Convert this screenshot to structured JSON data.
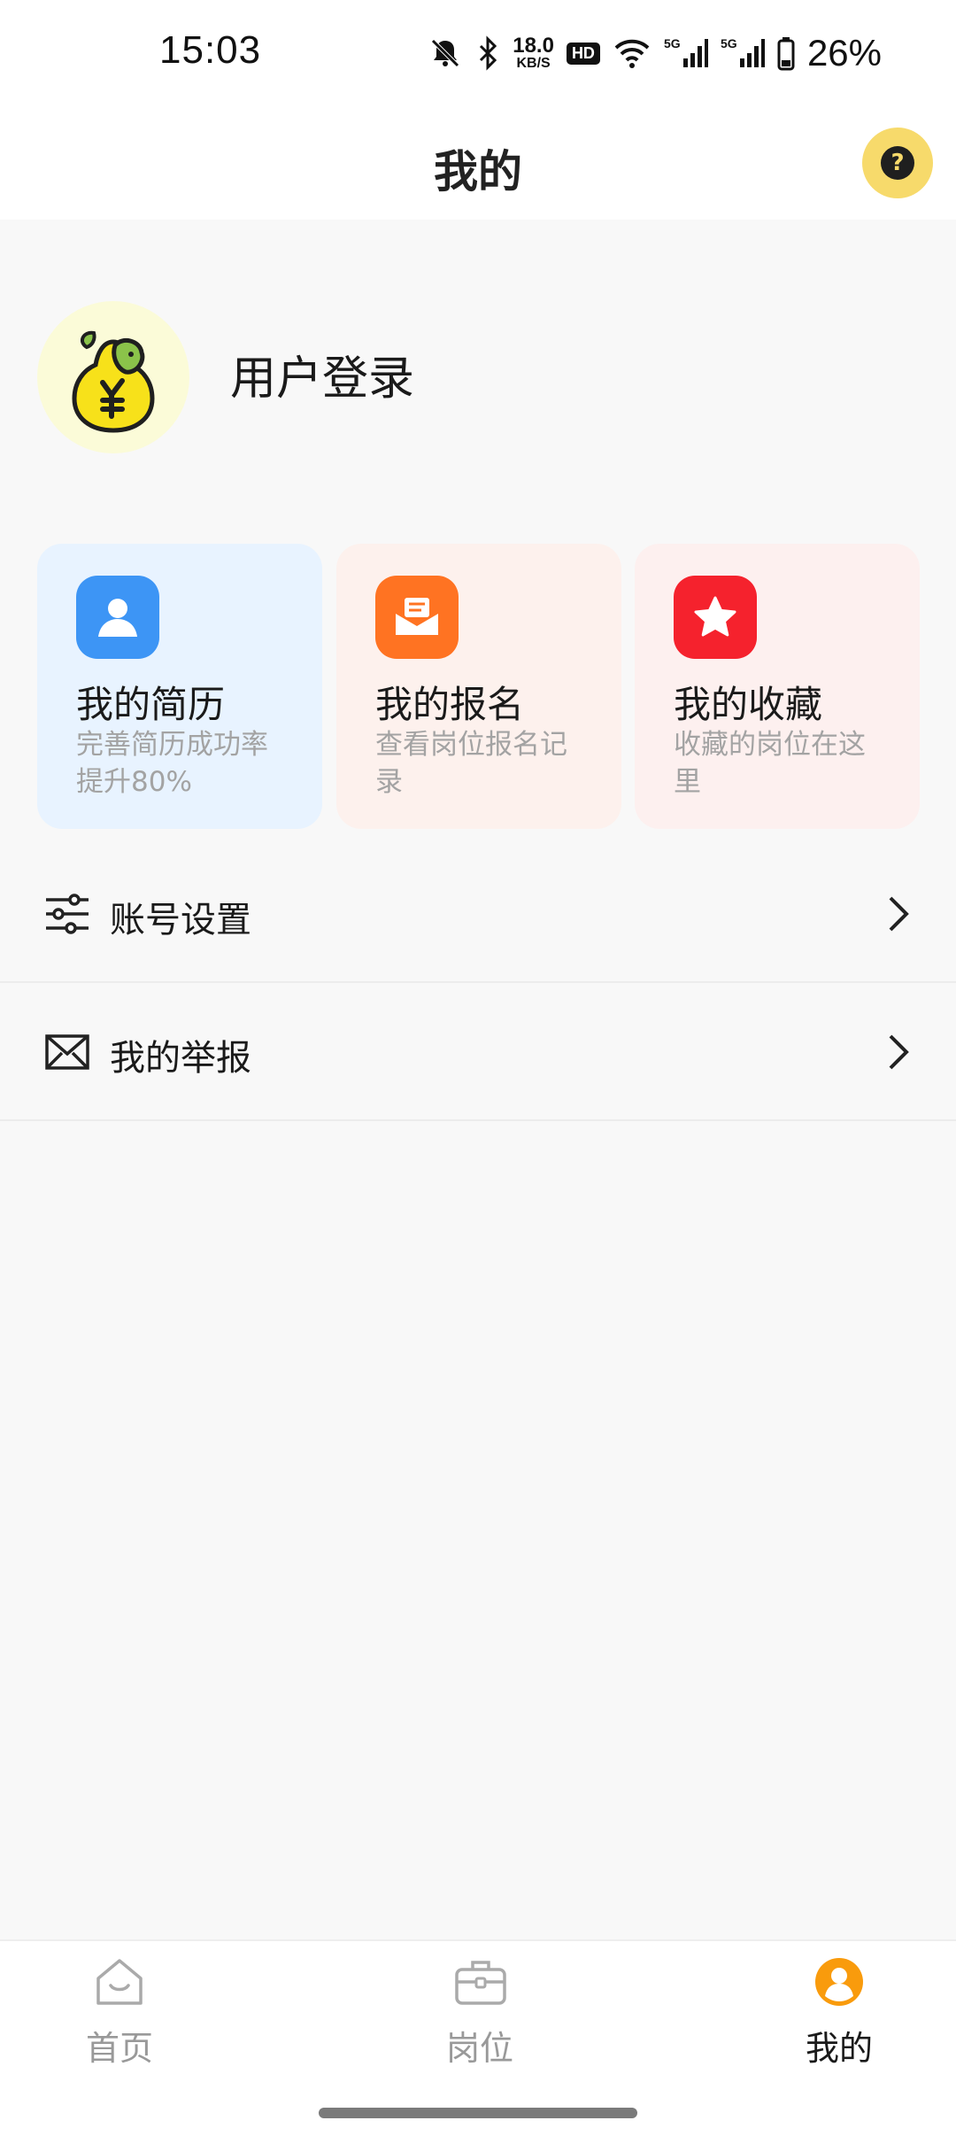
{
  "status_bar": {
    "time": "15:03",
    "speed_value": "18.0",
    "speed_unit": "KB/S",
    "hd_label": "HD",
    "network_1": "5G",
    "network_2": "5G",
    "battery": "26%"
  },
  "header": {
    "title": "我的",
    "help_icon": "question-icon",
    "help_symbol": "?"
  },
  "user": {
    "login_label": "用户登录",
    "avatar_icon": "pear-yuan-logo"
  },
  "cards": [
    {
      "title": "我的简历",
      "desc": "完善简历成功率提升80%",
      "icon": "person-icon",
      "color": "#3d95f5"
    },
    {
      "title": "我的报名",
      "desc": "查看岗位报名记录",
      "icon": "mail-open-icon",
      "color": "#ff7322"
    },
    {
      "title": "我的收藏",
      "desc": "收藏的岗位在这里",
      "icon": "star-icon",
      "color": "#f5222d"
    }
  ],
  "menu": [
    {
      "label": "账号设置",
      "icon": "sliders-icon"
    },
    {
      "label": "我的举报",
      "icon": "envelope-icon"
    }
  ],
  "bottom_nav": [
    {
      "label": "首页",
      "icon": "home-icon",
      "active": false
    },
    {
      "label": "岗位",
      "icon": "briefcase-icon",
      "active": false
    },
    {
      "label": "我的",
      "icon": "profile-icon",
      "active": true
    }
  ],
  "colors": {
    "accent": "#f99b0c",
    "inactive": "#999999",
    "help_bg": "#f7da6b"
  }
}
